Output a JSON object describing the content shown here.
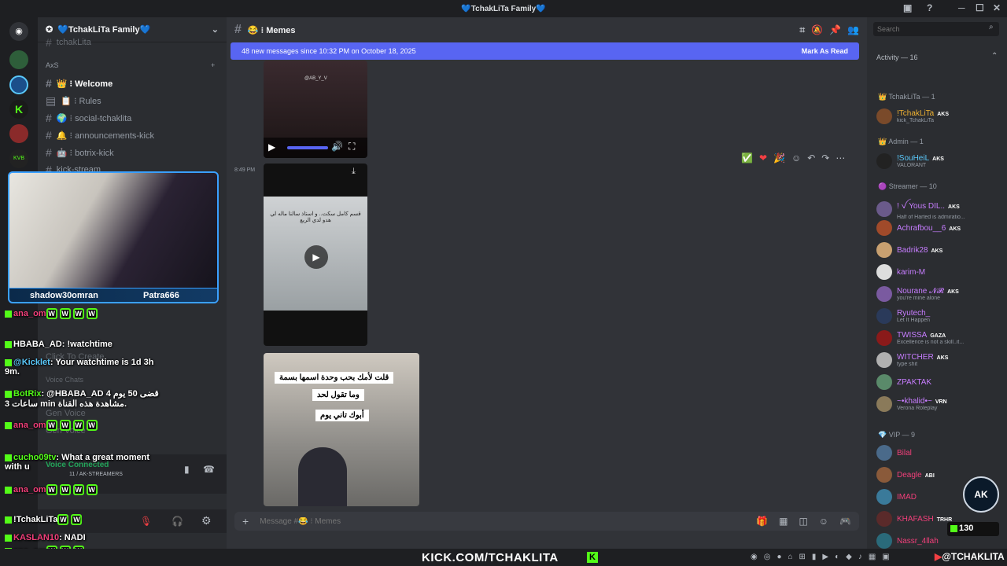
{
  "window": {
    "title": "💙TchakLiTa Family💙"
  },
  "server": {
    "name": "💙TchakLiTa Family💙"
  },
  "channels": {
    "partial_top": "tchakLita",
    "category": "AxS",
    "items": [
      {
        "label": "👑 ⁝ Welcome",
        "active": true
      },
      {
        "label": "📋 ⁝ Rules"
      },
      {
        "label": "🌍 ⁝ social-tchaklita"
      },
      {
        "label": "🔔 ⁝ announcements-kick"
      },
      {
        "label": "🤖 ⁝ botrix-kick"
      },
      {
        "label": "kick-stream"
      }
    ],
    "partial_labels": [
      "Click To Create",
      "Voice Chats",
      "Gen Voice",
      "Gen Voice"
    ],
    "voice": {
      "status": "Voice Connected",
      "channel": "11 / AK-STREAMERS"
    }
  },
  "main": {
    "channel": "😂 ⁝ Memes",
    "banner": {
      "text": "48 new messages since 10:32 PM on October 18, 2025",
      "action": "Mark As Read"
    },
    "timestamp": "8:49 PM",
    "image_text": [
      "قلت لأمك بحب وحدة اسمها بسمة",
      "وما تقول لحد",
      "أبوك تاني يوم"
    ],
    "video_caption": "قسم كامل سكت.. و استاذ سالنا ماله لي هدو لدي الربع",
    "watermark": "@AB_Y_V",
    "composer_placeholder": "Message #😂 ⁝ Memes"
  },
  "search": {
    "placeholder": "Search"
  },
  "members": {
    "header": "Activity — 16",
    "groups": [
      {
        "label": "👑 TchakLiTa — 1"
      },
      {
        "label": "👑 Admin — 1"
      },
      {
        "label": "🟣 Streamer — 10"
      },
      {
        "label": "💎 VIP — 9"
      }
    ],
    "list": [
      {
        "name": "!TchakLiTa",
        "tag": "AKS",
        "sub": "kick_TchakLiTa",
        "color": "#f0b232"
      },
      {
        "name": "!SouHeiL",
        "tag": "AKS",
        "sub": "VALORANT",
        "color": "#5ac8fa"
      },
      {
        "name": "! ꪜ Yous DIL..",
        "tag": "AKS",
        "sub": "Half of Harted is admiratio...",
        "color": "#c77dff"
      },
      {
        "name": "Achrafbou__6",
        "tag": "AKS",
        "sub": "",
        "color": "#c77dff"
      },
      {
        "name": "Badrik28",
        "tag": "AKS",
        "sub": "",
        "color": "#c77dff"
      },
      {
        "name": "karim-M",
        "tag": "",
        "sub": "",
        "color": "#c77dff"
      },
      {
        "name": "Nourane 𝓝𝓡",
        "tag": "AKS",
        "sub": "you're mine alone",
        "color": "#c77dff"
      },
      {
        "name": "Ryutech_",
        "tag": "",
        "sub": "Let It Happen",
        "color": "#c77dff"
      },
      {
        "name": "TWISSA",
        "tag": "GAZA",
        "sub": "Excellence is not a skill..it...",
        "color": "#c77dff"
      },
      {
        "name": "WITCHER",
        "tag": "AKS",
        "sub": "type shit",
        "color": "#c77dff"
      },
      {
        "name": "ZPAKTAK",
        "tag": "",
        "sub": "",
        "color": "#c77dff"
      },
      {
        "name": "~•khalid•~",
        "tag": "VRN",
        "sub": "Verona Roleplay",
        "color": "#c77dff"
      },
      {
        "name": "Bilal",
        "tag": "",
        "sub": "",
        "color": "#f23f7a"
      },
      {
        "name": "Deagle",
        "tag": "ABI",
        "sub": "",
        "color": "#f23f7a"
      },
      {
        "name": "IMAD",
        "tag": "",
        "sub": "",
        "color": "#f23f7a"
      },
      {
        "name": "KHAFASH",
        "tag": "TRHR",
        "sub": "",
        "color": "#f23f7a"
      },
      {
        "name": "Nassr_4llah",
        "tag": "",
        "sub": "",
        "color": "#f23f7a"
      }
    ]
  },
  "overlay": {
    "webcam_left": "shadow30omran",
    "webcam_right": "Patra666",
    "chat": [
      {
        "user": "ana_om",
        "text": "",
        "w": 4
      },
      {
        "user": "HBABA_AD",
        "text": ": !watchtime"
      },
      {
        "user": "@Kicklet",
        "text": ": Your watchtime is 1d 3h 9m."
      },
      {
        "user": "BotRix",
        "text": ": @HBABA_AD قضى 50 يوم 4 ساعات 3 min مشاهدة هذه القناة."
      },
      {
        "user": "ana_om",
        "text": "",
        "w": 4
      },
      {
        "user": "cucho09tv",
        "text": ": What a great moment with u"
      },
      {
        "user": "ana_om",
        "text": "",
        "w": 4
      },
      {
        "user": "!TchakLiTa",
        "text": "",
        "w": 2
      },
      {
        "user": "KASLAN10",
        "text": ": NADI"
      },
      {
        "user": "ana_om",
        "text": "",
        "w": 3
      }
    ],
    "w_letter": "W",
    "footer_url": "KICK.COM/TCHAKLITA",
    "footer_brand": "@TCHAKLITA",
    "viewers": "130",
    "logo_text": "AK"
  }
}
